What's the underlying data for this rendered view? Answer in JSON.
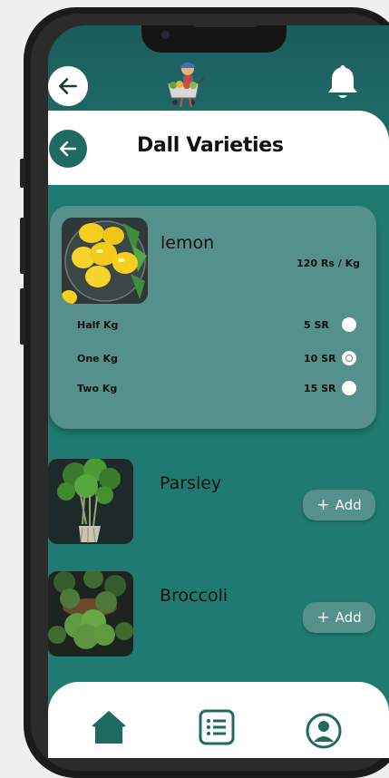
{
  "header": {
    "back_icon": "arrow-left-icon",
    "logo": "shopping-cart-character-logo",
    "notification_icon": "bell-icon"
  },
  "title_bar": {
    "title": "Dall Varieties",
    "back_icon": "arrow-left-icon"
  },
  "selected_product": {
    "name": "lemon",
    "price": "120 Rs / Kg",
    "options": [
      {
        "label": "Half Kg",
        "price": "5 SR",
        "selected": false
      },
      {
        "label": "One Kg",
        "price": "10 SR",
        "selected": true
      },
      {
        "label": "Two Kg",
        "price": "15 SR",
        "selected": false
      }
    ]
  },
  "products": [
    {
      "name": "Parsley",
      "add_label": "Add",
      "add_icon": "plus-icon"
    },
    {
      "name": "Broccoli",
      "add_label": "Add",
      "add_icon": "plus-icon"
    }
  ],
  "bottom_nav": {
    "items": [
      {
        "icon": "home-icon"
      },
      {
        "icon": "list-icon"
      },
      {
        "icon": "profile-icon"
      }
    ]
  },
  "colors": {
    "primary": "#1f7b72",
    "card": "#55908c",
    "dark_green": "#1f6b62",
    "white": "#ffffff"
  }
}
